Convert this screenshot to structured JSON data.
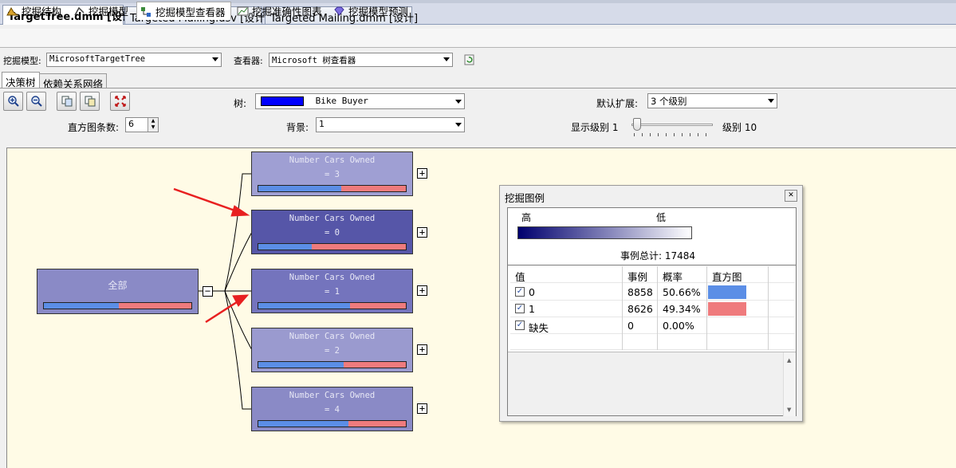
{
  "doc_tabs": [
    {
      "label": "TargetTree.dmm [设计]",
      "active": true
    },
    {
      "label": "Targeted Mailing.dsv [设计]",
      "active": false
    },
    {
      "label": "Targeted Mailing.dmm [设计]",
      "active": false
    }
  ],
  "designer_tabs": [
    {
      "label": "挖掘结构",
      "icon": "mining-structure-icon"
    },
    {
      "label": "挖掘模型",
      "icon": "mining-model-icon"
    },
    {
      "label": "挖掘模型查看器",
      "icon": "model-viewer-icon",
      "active": true
    },
    {
      "label": "挖掘准确性图表",
      "icon": "accuracy-chart-icon"
    },
    {
      "label": "挖掘模型预测",
      "icon": "prediction-icon"
    }
  ],
  "selectors": {
    "model_label": "挖掘模型:",
    "model_value": "MicrosoftTargetTree",
    "viewer_label": "查看器:",
    "viewer_value": "Microsoft 树查看器"
  },
  "sub_tabs": [
    {
      "label": "决策树",
      "active": true
    },
    {
      "label": "依赖关系网络",
      "active": false
    }
  ],
  "controls": {
    "tree_label": "树:",
    "tree_value": "Bike Buyer",
    "tree_color": "#0000ff",
    "default_expand_label": "默认扩展:",
    "default_expand_value": "3 个级别",
    "histogram_label": "直方图条数:",
    "histogram_value": "6",
    "background_label": "背景:",
    "background_value": "1",
    "show_level_label": "显示级别",
    "show_level_min": "1",
    "level_label": "级别",
    "level_max": "10",
    "slider_level": 1
  },
  "tree": {
    "root": {
      "label": "全部",
      "blue_fraction": 0.51
    },
    "children": [
      {
        "title": "Number Cars Owned",
        "value": "= 3",
        "blue_fraction": 0.56,
        "shade": "#9f9fd3"
      },
      {
        "title": "Number Cars Owned",
        "value": "= 0",
        "blue_fraction": 0.36,
        "shade": "#5656a8"
      },
      {
        "title": "Number Cars Owned",
        "value": "= 1",
        "blue_fraction": 0.62,
        "shade": "#7474bd"
      },
      {
        "title": "Number Cars Owned",
        "value": "= 2",
        "blue_fraction": 0.58,
        "shade": "#9a9acf"
      },
      {
        "title": "Number Cars Owned",
        "value": "= 4",
        "blue_fraction": 0.61,
        "shade": "#8a8ac6"
      }
    ]
  },
  "legend": {
    "title": "挖掘图例",
    "high": "高",
    "low": "低",
    "total_label": "事例总计:",
    "total_value": "17484",
    "columns": [
      "值",
      "事例",
      "概率",
      "直方图"
    ],
    "rows": [
      {
        "value": "0",
        "cases": "8858",
        "prob": "50.66%",
        "color": "#5b8ee6"
      },
      {
        "value": "1",
        "cases": "8626",
        "prob": "49.34%",
        "color": "#ef7b7d"
      },
      {
        "value": "缺失",
        "cases": "0",
        "prob": "0.00%",
        "color": ""
      }
    ]
  }
}
